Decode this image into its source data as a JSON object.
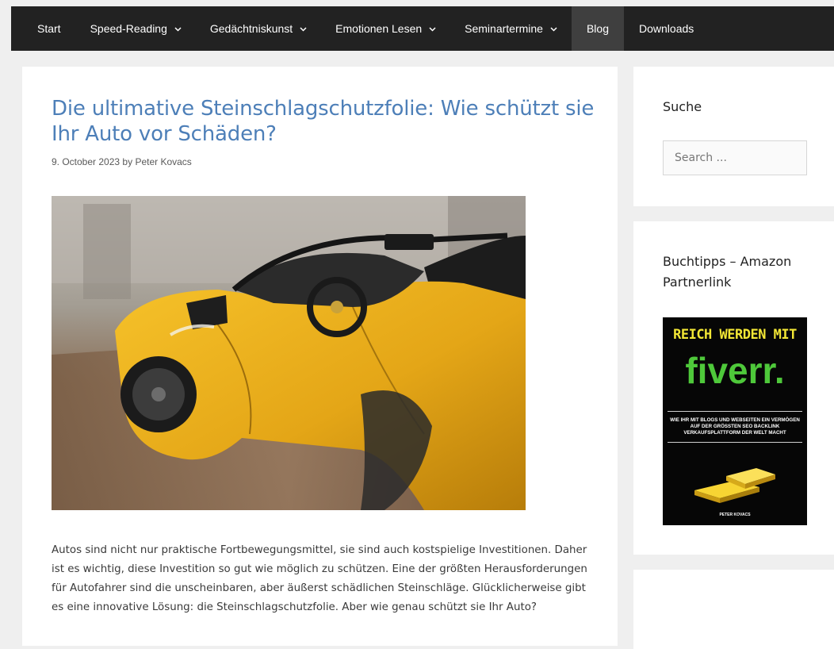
{
  "nav": {
    "items": [
      {
        "label": "Start",
        "dropdown": false,
        "active": false
      },
      {
        "label": "Speed-Reading",
        "dropdown": true,
        "active": false
      },
      {
        "label": "Gedächtniskunst",
        "dropdown": true,
        "active": false
      },
      {
        "label": "Emotionen Lesen",
        "dropdown": true,
        "active": false
      },
      {
        "label": "Seminartermine",
        "dropdown": true,
        "active": false
      },
      {
        "label": "Blog",
        "dropdown": false,
        "active": true
      },
      {
        "label": "Downloads",
        "dropdown": false,
        "active": false
      }
    ]
  },
  "article": {
    "title": "Die ultimative Steinschlagschutzfolie: Wie schützt sie Ihr Auto vor Schäden?",
    "date": "9. October 2023",
    "by": "by",
    "author": "Peter Kovacs",
    "image_icon": "yellow-convertible-car-photo",
    "body": "Autos sind nicht nur praktische Fortbewegungsmittel, sie sind auch kostspielige Investitionen. Daher ist es wichtig, diese Investition so gut wie möglich zu schützen. Eine der größten Herausforderungen für Autofahrer sind die unscheinbaren, aber äußerst schädlichen Steinschläge. Glücklicherweise gibt es eine innovative Lösung: die Steinschlagschutzfolie. Aber wie genau schützt sie Ihr Auto?"
  },
  "sidebar": {
    "search_title": "Suche",
    "search_placeholder": "Search ...",
    "books_title": "Buchtipps – Amazon Partnerlink",
    "book": {
      "headline": "REICH WERDEN MIT",
      "brand": "fiverr.",
      "subtitle": "WIE IHR MIT BLOGS UND WEBSEITEN EIN VERMÖGEN AUF DER GRÖSSTEN SEO BACKLINK VERKAUFSPLATTFORM DER WELT MACHT",
      "author": "PETER KOVACS"
    }
  },
  "colors": {
    "nav_bg": "#222222",
    "nav_active_bg": "#3f3f3f",
    "title_link": "#4d7fb8",
    "page_bg": "#efefef",
    "book_head_yellow": "#f3e735",
    "book_brand_green": "#4ec83a"
  }
}
